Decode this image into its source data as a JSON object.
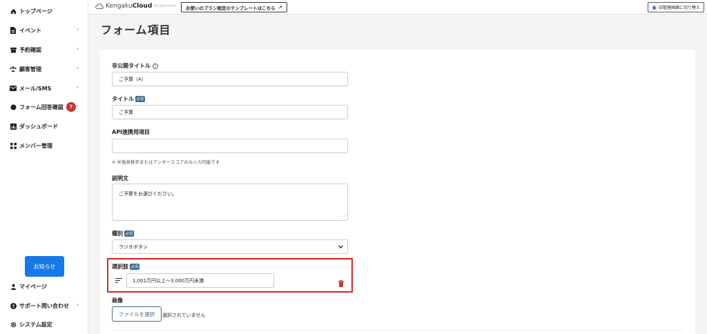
{
  "sidebar": {
    "items": [
      {
        "label": "トップページ",
        "icon": "home-icon"
      },
      {
        "label": "イベント",
        "icon": "document-icon",
        "chevron": "›"
      },
      {
        "label": "予約確認",
        "icon": "archive-icon",
        "chevron": "›"
      },
      {
        "label": "顧客管理",
        "icon": "people-icon",
        "chevron": "›"
      },
      {
        "label": "メール/SMS",
        "icon": "mail-icon",
        "chevron": "›"
      },
      {
        "label": "フォーム回答確認",
        "icon": "chat-icon",
        "badge": "7",
        "chevron": "›"
      },
      {
        "label": "ダッシュボード",
        "icon": "chart-icon"
      },
      {
        "label": "メンバー管理",
        "icon": "grid-icon"
      }
    ],
    "notice_button": "お知らせ",
    "bottom_items": [
      {
        "label": "マイページ",
        "icon": "user-icon"
      },
      {
        "label": "サポート問い合わせ",
        "icon": "help-icon",
        "chevron": "›"
      },
      {
        "label": "システム設定",
        "icon": "gear-icon"
      }
    ]
  },
  "topbar": {
    "logo_a": "Kengaku",
    "logo_b": "Cloud",
    "logo_sub": "ケンガククラウド",
    "plan_button": "お使いのプラン限定のテンプレートはこちら",
    "switch_button": "旧管理画面に切り替え"
  },
  "page": {
    "title": "フォーム項目"
  },
  "form": {
    "private_title": {
      "label": "非公開タイトル",
      "value": "ご予算（A）"
    },
    "title": {
      "label": "タイトル",
      "required": "必須",
      "value": "ご予算"
    },
    "api": {
      "label": "API連携用項目",
      "value": "",
      "hint": "※ 半角英数字またはアンダースコアのみ入力可能です"
    },
    "description": {
      "label": "説明文",
      "value": "ご予算をお選びください。"
    },
    "type": {
      "label": "種別",
      "required": "必須",
      "value": "ラジオボタン"
    },
    "options": {
      "label": "選択肢",
      "required": "必須",
      "items": [
        "1,001万円以上～3,000万円未満"
      ]
    },
    "image": {
      "label": "画像",
      "button": "ファイルを選択",
      "status": "選択されていません"
    }
  },
  "colors": {
    "accent": "#1679e8",
    "required_badge": "#3d6b8f",
    "highlight": "#e02020",
    "badge": "#c0392b",
    "trash": "#c0392b"
  }
}
